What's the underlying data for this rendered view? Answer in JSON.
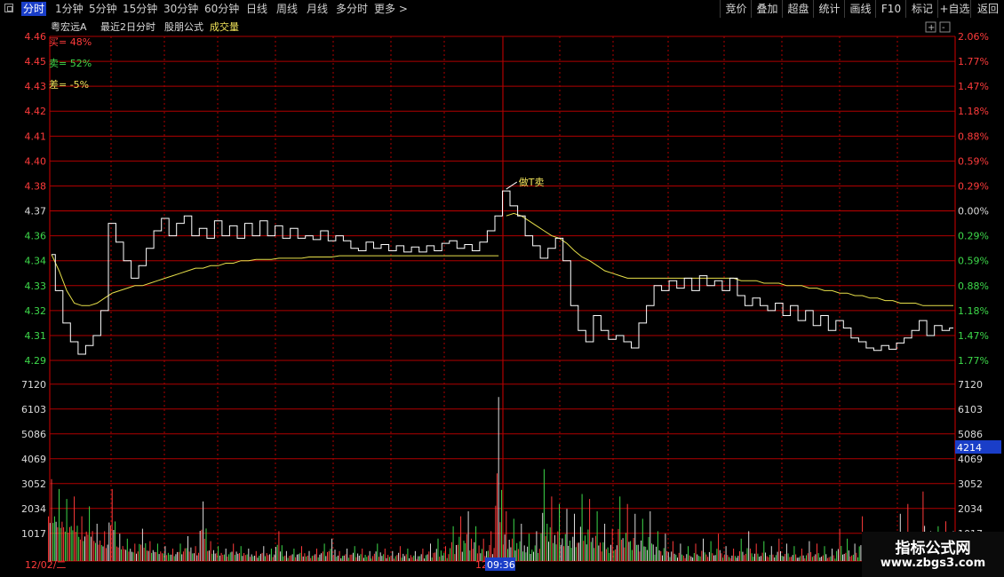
{
  "toolbar": {
    "periods": [
      "分时",
      "1分钟",
      "5分钟",
      "15分钟",
      "30分钟",
      "60分钟",
      "日线",
      "周线",
      "月线",
      "多分时",
      "更多 >"
    ],
    "active_index": 0,
    "right_buttons": [
      "竞价",
      "叠加",
      "超盘",
      "统计",
      "画线",
      "F10",
      "标记",
      "+自选",
      "返回"
    ]
  },
  "info_bar": {
    "stock_name": "粤宏远A",
    "mode": "最近2日分时",
    "formula": "股朋公式",
    "volume_label": "成交量"
  },
  "indicators": {
    "buy": "买= 48%",
    "sell": "卖= 52%",
    "diff": "差= -5%"
  },
  "annotation": "做T卖",
  "volume_cursor_value": "4214",
  "date_label": "12/02/二",
  "date_label_2": "12",
  "time_label": "09:36",
  "watermark": {
    "title": "指标公式网",
    "url": "www.zbgs3.com"
  },
  "colors": {
    "price_line": "#ffffff",
    "avg_line": "#e8e04a",
    "grid": "#b00000",
    "up": "#ff3b3b",
    "down": "#3dd94a",
    "flat": "#dcdcdc",
    "highlight_box": "#1a3ec8"
  },
  "chart_data": {
    "type": "line",
    "price_axis_ticks": [
      {
        "price": "4.46",
        "pct": "2.06%",
        "c": "up"
      },
      {
        "price": "4.45",
        "pct": "1.77%",
        "c": "up"
      },
      {
        "price": "4.43",
        "pct": "1.47%",
        "c": "up"
      },
      {
        "price": "4.42",
        "pct": "1.18%",
        "c": "up"
      },
      {
        "price": "4.41",
        "pct": "0.88%",
        "c": "up"
      },
      {
        "price": "4.40",
        "pct": "0.59%",
        "c": "up"
      },
      {
        "price": "4.38",
        "pct": "0.29%",
        "c": "up"
      },
      {
        "price": "4.37",
        "pct": "0.00%",
        "c": "flat"
      },
      {
        "price": "4.36",
        "pct": "0.29%",
        "c": "down"
      },
      {
        "price": "4.34",
        "pct": "0.59%",
        "c": "down"
      },
      {
        "price": "4.33",
        "pct": "0.88%",
        "c": "down"
      },
      {
        "price": "4.32",
        "pct": "1.18%",
        "c": "down"
      },
      {
        "price": "4.31",
        "pct": "1.47%",
        "c": "down"
      },
      {
        "price": "4.29",
        "pct": "1.77%",
        "c": "down"
      }
    ],
    "volume_axis_ticks": [
      "7120",
      "6103",
      "5086",
      "4069",
      "3052",
      "2034",
      "1017"
    ],
    "price_range": [
      4.285,
      4.465
    ],
    "volume_range": [
      0,
      7120
    ],
    "days": 2,
    "price_series": [
      4.345,
      4.328,
      4.315,
      4.305,
      4.295,
      4.302,
      4.31,
      4.32,
      4.365,
      4.355,
      4.34,
      4.333,
      4.338,
      4.35,
      4.362,
      4.367,
      4.36,
      4.365,
      4.368,
      4.36,
      4.363,
      4.358,
      4.366,
      4.36,
      4.364,
      4.358,
      4.365,
      4.36,
      4.366,
      4.36,
      4.364,
      4.358,
      4.363,
      4.358,
      4.36,
      4.357,
      4.362,
      4.356,
      4.36,
      4.356,
      4.35,
      4.348,
      4.355,
      4.35,
      4.353,
      4.348,
      4.352,
      4.347,
      4.351,
      4.347,
      4.352,
      4.348,
      4.354,
      4.356,
      4.35,
      4.353,
      4.348,
      4.355,
      4.362,
      4.368,
      4.378,
      4.372,
      4.368,
      4.36,
      4.352,
      4.342,
      4.35,
      4.358,
      4.34,
      4.322,
      4.312,
      4.305,
      4.318,
      4.312,
      4.307,
      4.31,
      4.305,
      4.3,
      4.315,
      4.322,
      4.33,
      4.328,
      4.332,
      4.329,
      4.333,
      4.328,
      4.334,
      4.33,
      4.332,
      4.328,
      4.333,
      4.326,
      4.322,
      4.325,
      4.322,
      4.32,
      4.323,
      4.318,
      4.322,
      4.316,
      4.32,
      4.314,
      4.318,
      4.312,
      4.316,
      4.313,
      4.308,
      4.305,
      4.3,
      4.298,
      4.302,
      4.299,
      4.304,
      4.308,
      4.312,
      4.316,
      4.31,
      4.314,
      4.312,
      4.313
    ],
    "avg_series": [
      4.345,
      4.336,
      4.328,
      4.323,
      4.322,
      4.322,
      4.323,
      4.325,
      4.327,
      4.328,
      4.329,
      4.33,
      4.33,
      4.331,
      4.332,
      4.333,
      4.334,
      4.335,
      4.336,
      4.337,
      4.337,
      4.338,
      4.338,
      4.339,
      4.339,
      4.34,
      4.34,
      4.341,
      4.341,
      4.341,
      4.342,
      4.342,
      4.342,
      4.342,
      4.343,
      4.343,
      4.343,
      4.343,
      4.344,
      4.344,
      4.344,
      4.344,
      4.344,
      4.344,
      4.344,
      4.344,
      4.344,
      4.344,
      4.344,
      4.344,
      4.344,
      4.344,
      4.344,
      4.344,
      4.344,
      4.344,
      4.344,
      4.344,
      4.344,
      4.344,
      4.368,
      4.369,
      4.368,
      4.366,
      4.364,
      4.362,
      4.36,
      4.358,
      4.354,
      4.348,
      4.343,
      4.34,
      4.338,
      4.336,
      4.335,
      4.334,
      4.333,
      4.333,
      4.333,
      4.333,
      4.333,
      4.333,
      4.333,
      4.333,
      4.333,
      4.333,
      4.333,
      4.333,
      4.333,
      4.333,
      4.333,
      4.332,
      4.332,
      4.332,
      4.331,
      4.331,
      4.331,
      4.33,
      4.33,
      4.33,
      4.329,
      4.329,
      4.328,
      4.328,
      4.327,
      4.327,
      4.326,
      4.326,
      4.325,
      4.325,
      4.324,
      4.324,
      4.323,
      4.323,
      4.323,
      4.322,
      4.322,
      4.322,
      4.322,
      4.322
    ],
    "volume_series": [
      3300,
      2900,
      2500,
      2600,
      1800,
      2200,
      1500,
      1200,
      2900,
      1100,
      900,
      700,
      1300,
      800,
      700,
      600,
      500,
      700,
      1000,
      600,
      2400,
      800,
      600,
      500,
      700,
      600,
      500,
      400,
      600,
      500,
      1200,
      400,
      500,
      600,
      400,
      500,
      700,
      900,
      400,
      500,
      600,
      500,
      400,
      700,
      500,
      400,
      600,
      500,
      400,
      500,
      700,
      900,
      600,
      1400,
      1800,
      2000,
      1400,
      900,
      1200,
      6600,
      2000,
      1700,
      1500,
      1100,
      1200,
      3700,
      2600,
      2300,
      2100,
      1900,
      2700,
      2500,
      2000,
      1500,
      1300,
      2600,
      2300,
      1900,
      1700,
      2000,
      1200,
      1100,
      800,
      700,
      600,
      700,
      900,
      800,
      1100,
      600,
      500,
      900,
      1200,
      700,
      800,
      600,
      900,
      700,
      600,
      500,
      800,
      700,
      600,
      500,
      1300,
      900,
      700,
      1800,
      800,
      600,
      900,
      700,
      1900,
      2300,
      1000,
      2800,
      1200,
      1400,
      1600,
      1200
    ],
    "volume_colors": [
      "up",
      "down",
      "down",
      "up",
      "up",
      "down",
      "flat",
      "up",
      "up",
      "flat",
      "down",
      "up",
      "flat",
      "up",
      "down",
      "flat",
      "up",
      "down",
      "flat",
      "up",
      "flat",
      "up",
      "down",
      "flat",
      "up",
      "down",
      "flat",
      "up",
      "flat",
      "down",
      "up",
      "flat",
      "down",
      "up",
      "flat",
      "up",
      "down",
      "flat",
      "up",
      "flat",
      "down",
      "up",
      "flat",
      "down",
      "up",
      "flat",
      "up",
      "down",
      "flat",
      "up",
      "flat",
      "down",
      "up",
      "down",
      "up",
      "flat",
      "down",
      "up",
      "up",
      "flat",
      "up",
      "down",
      "flat",
      "down",
      "flat",
      "down",
      "up",
      "down",
      "flat",
      "flat",
      "down",
      "up",
      "down",
      "flat",
      "up",
      "down",
      "up",
      "flat",
      "down",
      "flat",
      "down",
      "flat",
      "up",
      "flat",
      "down",
      "up",
      "flat",
      "down",
      "up",
      "flat",
      "up",
      "down",
      "flat",
      "up",
      "down",
      "flat",
      "up",
      "flat",
      "down",
      "up",
      "flat",
      "up",
      "down",
      "flat",
      "up",
      "down",
      "flat",
      "up",
      "down",
      "flat",
      "up",
      "down",
      "flat",
      "up",
      "down",
      "up",
      "flat",
      "down",
      "up",
      "flat"
    ],
    "peak_index": 60
  }
}
